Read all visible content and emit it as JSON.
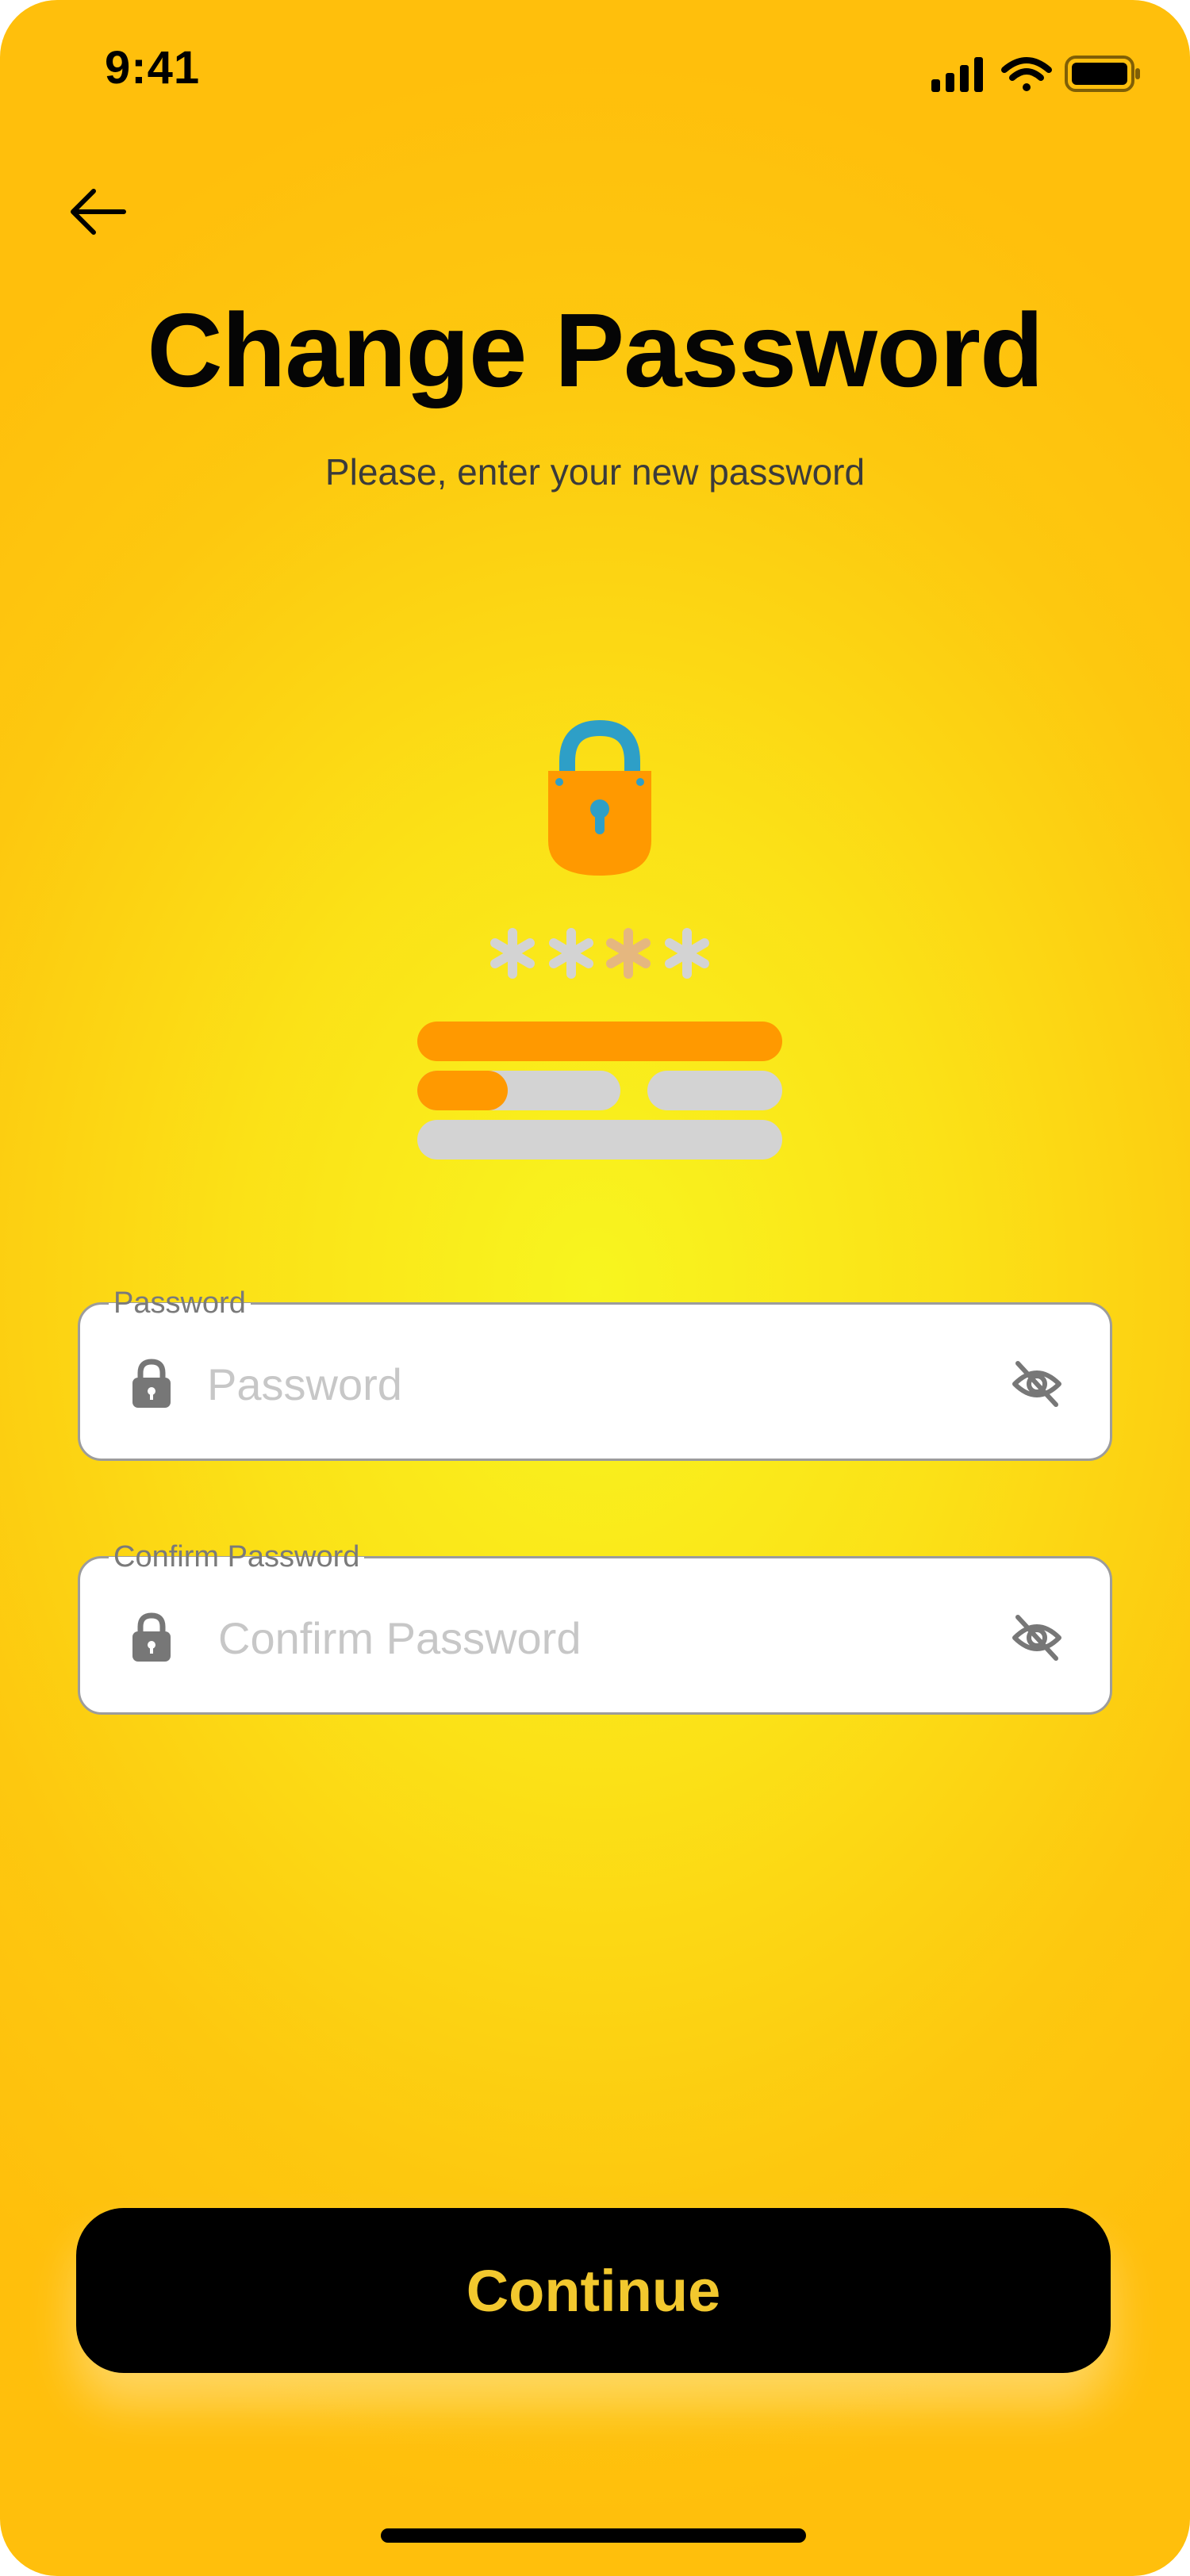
{
  "status_bar": {
    "time": "9:41",
    "icons": [
      "cellular-signal-icon",
      "wifi-icon",
      "battery-icon"
    ]
  },
  "header": {
    "back_icon": "arrow-left-icon",
    "title": "Change Password",
    "subtitle": "Please, enter your new password"
  },
  "illustration": {
    "description_icon": "password-lock-illustration"
  },
  "form": {
    "password": {
      "label": "Password",
      "placeholder": "Password",
      "value": "",
      "leading_icon": "lock-icon",
      "trailing_icon": "eye-off-icon"
    },
    "confirm_password": {
      "label": "Confirm Password",
      "placeholder": "Confirm Password",
      "value": "",
      "leading_icon": "lock-icon",
      "trailing_icon": "eye-off-icon"
    }
  },
  "actions": {
    "continue_label": "Continue"
  },
  "colors": {
    "background_center": "#f8f51f",
    "background_edge": "#ffbf0c",
    "button_bg": "#000000",
    "button_text": "#f2c82e",
    "illustration_orange": "#ff9900",
    "illustration_blue": "#2e9fc7",
    "illustration_gray": "#d3d3d3"
  }
}
